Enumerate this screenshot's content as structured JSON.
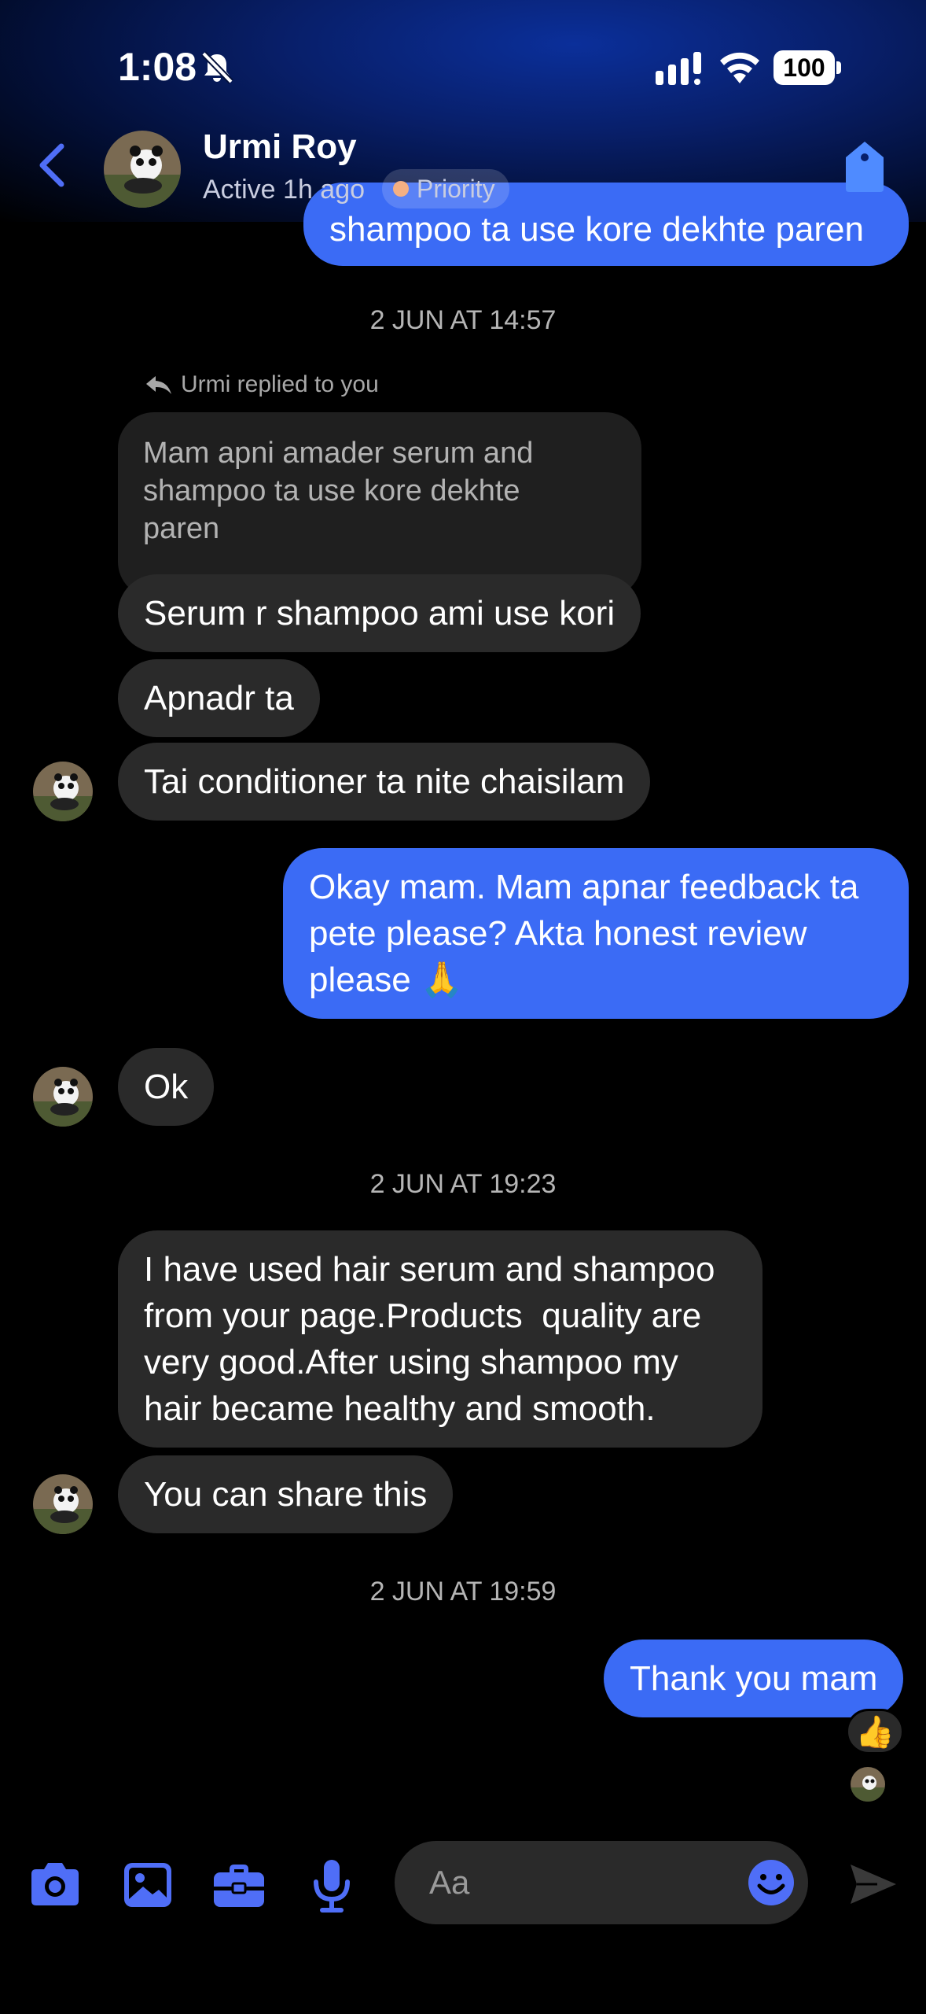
{
  "status_bar": {
    "time": "1:08",
    "battery": "100"
  },
  "header": {
    "contact_name": "Urmi Roy",
    "active_status": "Active 1h ago",
    "priority_label": "Priority"
  },
  "messages": {
    "partial_out": "shampoo ta use kore dekhte paren",
    "ts1": "2 JUN AT 14:57",
    "reply_note": "Urmi replied to you",
    "quoted": "Mam apni amader serum and\nshampoo ta use kore dekhte\nparen",
    "in1": "Serum r shampoo ami use kori",
    "in2": "Apnadr ta",
    "in3": "Tai conditioner ta nite chaisilam",
    "out1": "Okay mam. Mam apnar feedback ta\npete please? Akta honest review\nplease 🙏",
    "in4": "Ok",
    "ts2": "2 JUN AT 19:23",
    "in5": "I have used hair serum and shampoo\nfrom your page.Products  quality are\nvery good.After using shampoo my\nhair became healthy and smooth.",
    "in6": "You can share this",
    "ts3": "2 JUN AT 19:59",
    "out2": "Thank you mam",
    "reaction": "👍"
  },
  "composer": {
    "placeholder": "Aa"
  },
  "colors": {
    "accent": "#3b6bf5",
    "incoming": "#2a2a2a",
    "icon_blue": "#4f6ef7"
  }
}
